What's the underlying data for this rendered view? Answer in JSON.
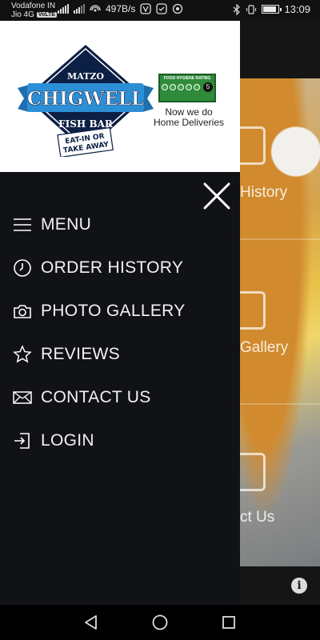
{
  "status_bar": {
    "carrier_1": "Vodafone IN",
    "carrier_2": "Jio 4G",
    "volte": "VoLTE",
    "net_speed": "497B/s",
    "time": "13:09",
    "battery_level": 0.8
  },
  "drawer": {
    "logo": {
      "top_text": "MATZO",
      "brand": "CHIGWELL",
      "sub": "FISH BAR",
      "stamp_line1": "EAT-IN OR",
      "stamp_line2": "TAKE AWAY"
    },
    "hygiene_badge": {
      "title": "FOOD HYGIENE RATING",
      "rating": "5"
    },
    "tagline_1": "Now we do",
    "tagline_2": "Home Deliveries",
    "menu_items": [
      {
        "label": "MENU",
        "icon": "hamburger-icon"
      },
      {
        "label": "ORDER HISTORY",
        "icon": "clock-icon"
      },
      {
        "label": "PHOTO GALLERY",
        "icon": "camera-icon"
      },
      {
        "label": "REVIEWS",
        "icon": "star-icon"
      },
      {
        "label": "CONTACT US",
        "icon": "envelope-icon"
      },
      {
        "label": "LOGIN",
        "icon": "login-icon"
      }
    ]
  },
  "background": {
    "tile_labels": [
      "History",
      "Gallery",
      "ct Us"
    ]
  },
  "colors": {
    "drawer_bg": "#101215",
    "header_bg": "#ffffff",
    "logo_blue": "#2c8fd6",
    "logo_navy": "#0c1f44",
    "hygiene_green": "#2f8a3a"
  }
}
